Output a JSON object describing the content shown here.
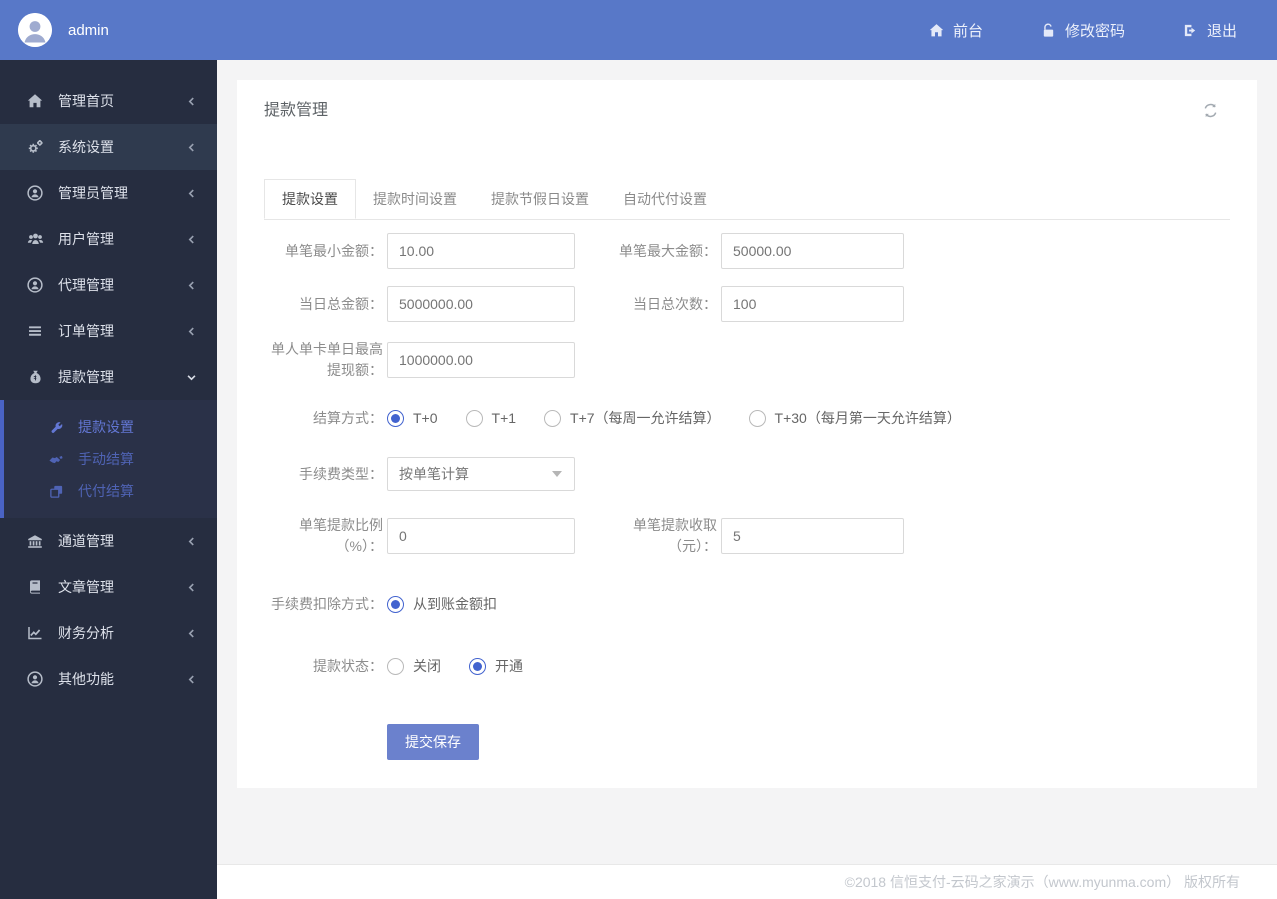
{
  "page": {
    "title": "提款管理"
  },
  "header": {
    "username": "admin",
    "nav": [
      {
        "label": "前台",
        "icon": "home-icon"
      },
      {
        "label": "修改密码",
        "icon": "unlock-icon"
      },
      {
        "label": "退出",
        "icon": "logout-icon"
      }
    ]
  },
  "sidebar": {
    "items": [
      {
        "label": "管理首页",
        "icon": "home-icon",
        "state": "collapsed"
      },
      {
        "label": "系统设置",
        "icon": "cogs-icon",
        "state": "highlighted"
      },
      {
        "label": "管理员管理",
        "icon": "user-circle-icon",
        "state": "collapsed"
      },
      {
        "label": "用户管理",
        "icon": "users-icon",
        "state": "collapsed"
      },
      {
        "label": "代理管理",
        "icon": "user-circle-icon",
        "state": "collapsed"
      },
      {
        "label": "订单管理",
        "icon": "list-icon",
        "state": "collapsed"
      },
      {
        "label": "提款管理",
        "icon": "money-bag-icon",
        "state": "expanded"
      },
      {
        "label": "通道管理",
        "icon": "bank-icon",
        "state": "collapsed"
      },
      {
        "label": "文章管理",
        "icon": "book-icon",
        "state": "collapsed"
      },
      {
        "label": "财务分析",
        "icon": "chart-line-icon",
        "state": "collapsed"
      },
      {
        "label": "其他功能",
        "icon": "user-circle-icon",
        "state": "collapsed"
      }
    ],
    "submenu": [
      {
        "label": "提款设置",
        "icon": "wrench-icon",
        "active": true
      },
      {
        "label": "手动结算",
        "icon": "hands-icon",
        "active": false
      },
      {
        "label": "代付结算",
        "icon": "clone-icon",
        "active": false
      }
    ]
  },
  "tabs": [
    {
      "label": "提款设置",
      "active": true
    },
    {
      "label": "提款时间设置",
      "active": false
    },
    {
      "label": "提款节假日设置",
      "active": false
    },
    {
      "label": "自动代付设置",
      "active": false
    }
  ],
  "form": {
    "min_amount": {
      "label": "单笔最小金额：",
      "value": "10.00"
    },
    "max_amount": {
      "label": "单笔最大金额：",
      "value": "50000.00"
    },
    "daily_total": {
      "label": "当日总金额：",
      "value": "5000000.00"
    },
    "daily_count": {
      "label": "当日总次数：",
      "value": "100"
    },
    "person_daily_max": {
      "label": "单人单卡单日最高提现额：",
      "value": "1000000.00"
    },
    "settle_mode": {
      "label": "结算方式：",
      "options": [
        {
          "label": "T+0",
          "selected": true
        },
        {
          "label": "T+1",
          "selected": false
        },
        {
          "label": "T+7（每周一允许结算）",
          "selected": false
        },
        {
          "label": "T+30（每月第一天允许结算）",
          "selected": false
        }
      ]
    },
    "fee_type": {
      "label": "手续费类型：",
      "value": "按单笔计算"
    },
    "fee_percent": {
      "label": "单笔提款比例（%）：",
      "value": "0"
    },
    "fee_fixed": {
      "label": "单笔提款收取（元）：",
      "value": "5"
    },
    "fee_deduct": {
      "label": "手续费扣除方式：",
      "options": [
        {
          "label": "从到账金额扣",
          "selected": true
        }
      ]
    },
    "withdraw_status": {
      "label": "提款状态：",
      "options": [
        {
          "label": "关闭",
          "selected": false
        },
        {
          "label": "开通",
          "selected": true
        }
      ]
    },
    "submit_label": "提交保存"
  },
  "footer": {
    "copyright": "©2018 信恒支付-云码之家演示（www.myunma.com） 版权所有"
  },
  "colors": {
    "header_bg": "#5878c8",
    "sidebar_bg": "#262d40",
    "sidebar_active_bg": "#2f3a4e",
    "submenu_bg": "#2a3148",
    "submenu_border": "#4a63c4",
    "submenu_link": "#4f63b4",
    "accent_radio": "#4263cf",
    "button_bg": "#6b81cd",
    "page_bg": "#f4f4f5"
  }
}
